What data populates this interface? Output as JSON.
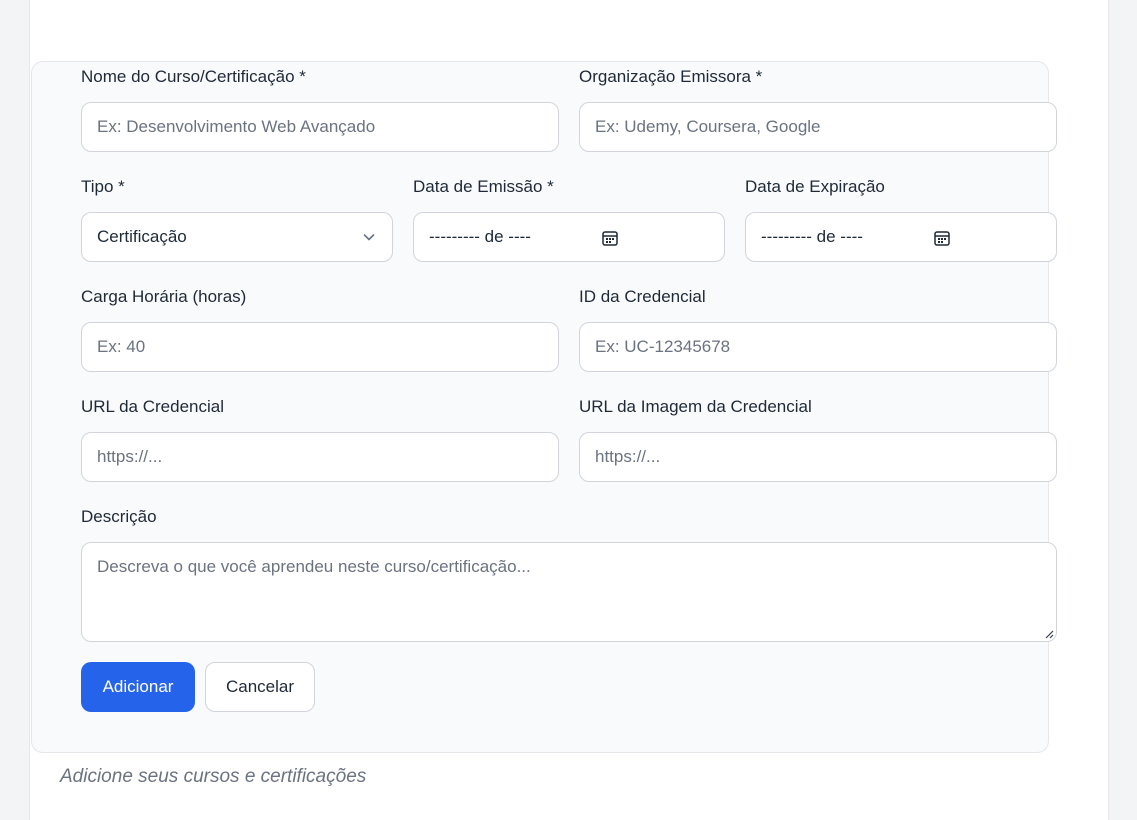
{
  "form": {
    "course_name": {
      "label": "Nome do Curso/Certificação *",
      "placeholder": "Ex: Desenvolvimento Web Avançado"
    },
    "issuer": {
      "label": "Organização Emissora *",
      "placeholder": "Ex: Udemy, Coursera, Google"
    },
    "type": {
      "label": "Tipo *",
      "value": "Certificação"
    },
    "issue_date": {
      "label": "Data de Emissão *",
      "value": "--------- de ----"
    },
    "expiry_date": {
      "label": "Data de Expiração",
      "value": "--------- de ----"
    },
    "hours": {
      "label": "Carga Horária (horas)",
      "placeholder": "Ex: 40"
    },
    "credential_id": {
      "label": "ID da Credencial",
      "placeholder": "Ex: UC-12345678"
    },
    "credential_url": {
      "label": "URL da Credencial",
      "placeholder": "https://..."
    },
    "credential_image_url": {
      "label": "URL da Imagem da Credencial",
      "placeholder": "https://..."
    },
    "description": {
      "label": "Descrição",
      "placeholder": "Descreva o que você aprendeu neste curso/certificação..."
    },
    "add_label": "Adicionar",
    "cancel_label": "Cancelar"
  },
  "empty_hint": "Adicione seus cursos e certificações",
  "colors": {
    "primary": "#2563eb",
    "panel_bg": "#f9fafb",
    "border": "#d1d5db"
  },
  "icons": {
    "select": "chevron-down-icon",
    "date": "calendar-icon"
  }
}
